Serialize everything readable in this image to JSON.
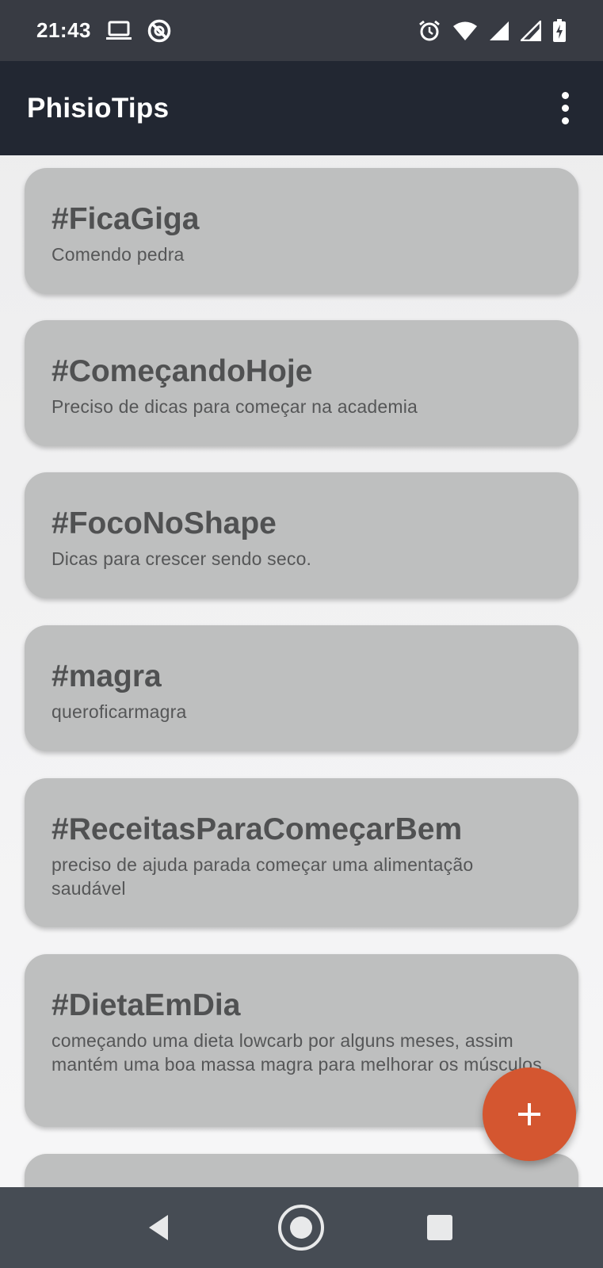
{
  "status_bar": {
    "time": "21:43",
    "left_icons": [
      "laptop-icon",
      "no-disturb-icon"
    ],
    "right_icons": [
      "alarm-icon",
      "wifi-icon",
      "signal-icon",
      "signal-icon",
      "battery-charging-icon"
    ]
  },
  "app_bar": {
    "title": "PhisioTips",
    "menu_icon": "more-vert-icon"
  },
  "cards": [
    {
      "title": "#FicaGiga",
      "description": "Comendo pedra"
    },
    {
      "title": "#ComeçandoHoje",
      "description": "Preciso de dicas para começar na academia"
    },
    {
      "title": "#FocoNoShape",
      "description": "Dicas para crescer sendo seco."
    },
    {
      "title": "#magra",
      "description": "queroficarmagra"
    },
    {
      "title": "#ReceitasParaComeçarBem",
      "description": "preciso de ajuda parada começar uma alimentação saudável"
    },
    {
      "title": "#DietaEmDia",
      "description": "começando uma dieta lowcarb por alguns meses, assim mantém uma boa massa magra para melhorar os músculos"
    }
  ],
  "fab": {
    "icon": "add-icon"
  },
  "colors": {
    "status_bar": "#383b43",
    "app_bar": "#222732",
    "card": "#bebfbf",
    "card_title": "#505152",
    "fab": "#d45630",
    "nav_bar": "#464c54"
  },
  "nav_bar": {
    "icons": [
      "back-icon",
      "home-icon",
      "recents-icon"
    ]
  }
}
